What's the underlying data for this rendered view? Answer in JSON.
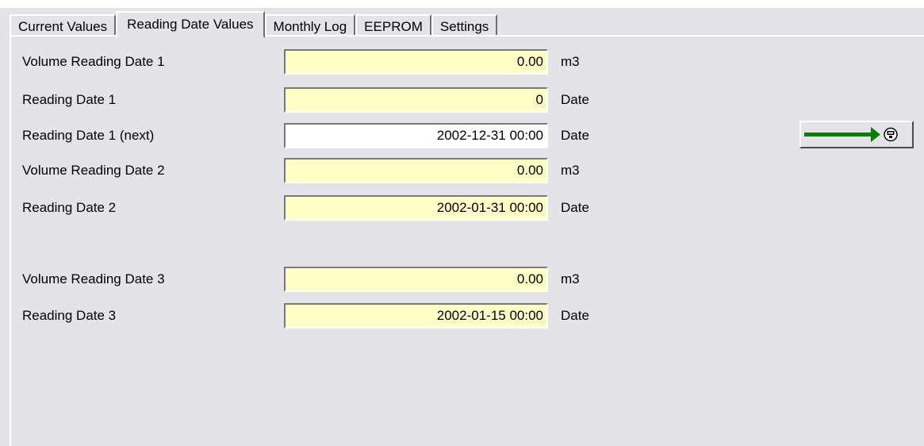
{
  "tabs": [
    {
      "label": "Current Values",
      "active": false
    },
    {
      "label": "Reading Date Values",
      "active": true
    },
    {
      "label": "Monthly Log",
      "active": false
    },
    {
      "label": "EEPROM",
      "active": false
    },
    {
      "label": "Settings",
      "active": false
    }
  ],
  "rows": [
    {
      "label": "Volume Reading Date 1",
      "value": "0.00",
      "unit": "m3",
      "editable": false
    },
    {
      "label": "Reading Date 1",
      "value": "0",
      "unit": "Date",
      "editable": false
    },
    {
      "label": "Reading Date 1 (next)",
      "value": "2002-12-31 00:00",
      "unit": "Date",
      "editable": true
    },
    {
      "label": "Volume Reading Date 2",
      "value": "0.00",
      "unit": "m3",
      "editable": false
    },
    {
      "label": "Reading Date 2",
      "value": "2002-01-31 00:00",
      "unit": "Date",
      "editable": false
    },
    {
      "label": "Volume Reading Date 3",
      "value": "0.00",
      "unit": "m3",
      "editable": false
    },
    {
      "label": "Reading Date 3",
      "value": "2002-01-15 00:00",
      "unit": "Date",
      "editable": false
    }
  ],
  "send_button": {
    "icons": [
      "green-arrow-right-icon",
      "device-icon"
    ]
  },
  "colors": {
    "readonly_field": "#ffffc6",
    "editable_field": "#ffffff",
    "panel": "#e3e3e8",
    "arrow": "#008000"
  }
}
